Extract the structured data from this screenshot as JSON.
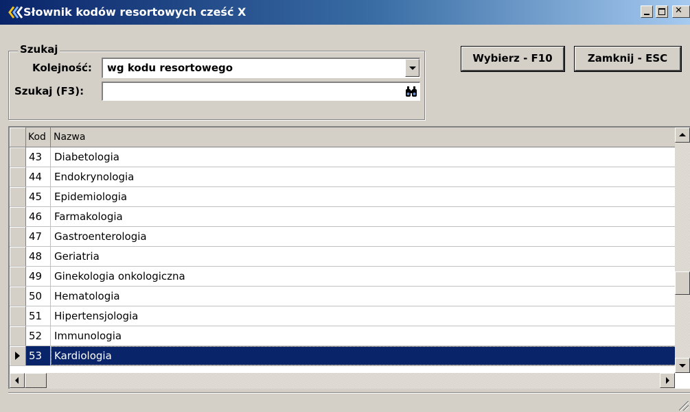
{
  "window": {
    "title": "Słownik kodów resortowych cześć X",
    "titlebar_color": "#0a246a",
    "controls": [
      "minimize-icon",
      "maximize-icon",
      "close-icon"
    ],
    "close_glyph": "✕"
  },
  "search": {
    "group_label": "Szukaj",
    "order_label": "Kolejność:",
    "order_value": "wg kodu resortowego",
    "search_label": "Szukaj (F3):",
    "search_value": "",
    "search_button_icon": "binoculars-icon"
  },
  "buttons": {
    "select": "Wybierz - F10",
    "close": "Zamknij - ESC"
  },
  "table": {
    "columns": [
      "Kod",
      "Nazwa"
    ],
    "selection_color": "#0a246a",
    "rows": [
      {
        "kod": "43",
        "nazwa": "Diabetologia"
      },
      {
        "kod": "44",
        "nazwa": "Endokrynologia"
      },
      {
        "kod": "45",
        "nazwa": "Epidemiologia"
      },
      {
        "kod": "46",
        "nazwa": "Farmakologia"
      },
      {
        "kod": "47",
        "nazwa": "Gastroenterologia"
      },
      {
        "kod": "48",
        "nazwa": "Geriatria"
      },
      {
        "kod": "49",
        "nazwa": "Ginekologia onkologiczna"
      },
      {
        "kod": "50",
        "nazwa": "Hematologia"
      },
      {
        "kod": "51",
        "nazwa": "Hipertensjologia"
      },
      {
        "kod": "52",
        "nazwa": "Immunologia"
      },
      {
        "kod": "53",
        "nazwa": "Kardiologia",
        "selected": true
      }
    ]
  }
}
